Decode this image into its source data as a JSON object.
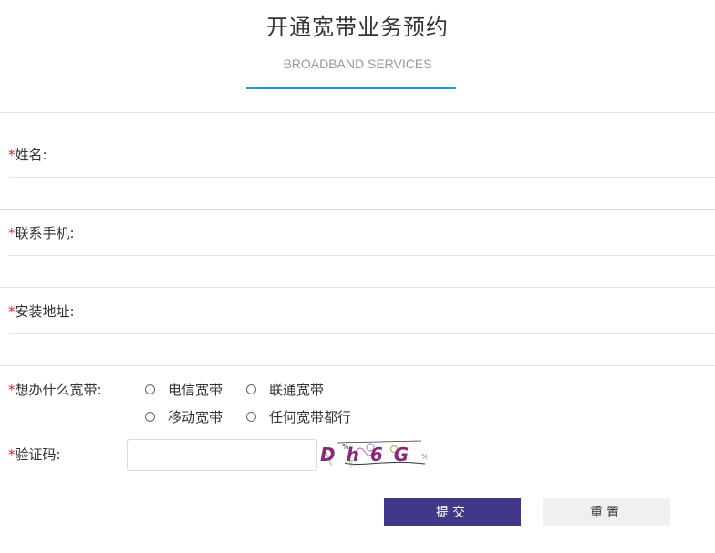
{
  "header": {
    "title": "开通宽带业务预约",
    "subtitle": "BROADBAND SERVICES"
  },
  "form": {
    "required_mark": "*",
    "name_label": "姓名:",
    "phone_label": "联系手机:",
    "address_label": "安装地址:",
    "broadband_label": "想办什么宽带:",
    "broadband_options": [
      "电信宽带",
      "联通宽带",
      "移动宽带",
      "任何宽带都行"
    ],
    "captcha_label": "验证码:",
    "captcha_text": "Dh6G"
  },
  "buttons": {
    "submit": "提交",
    "reset": "重置"
  },
  "colors": {
    "accent": "#1a9ad6",
    "submit_bg": "#3f3887",
    "required": "#e02020"
  }
}
